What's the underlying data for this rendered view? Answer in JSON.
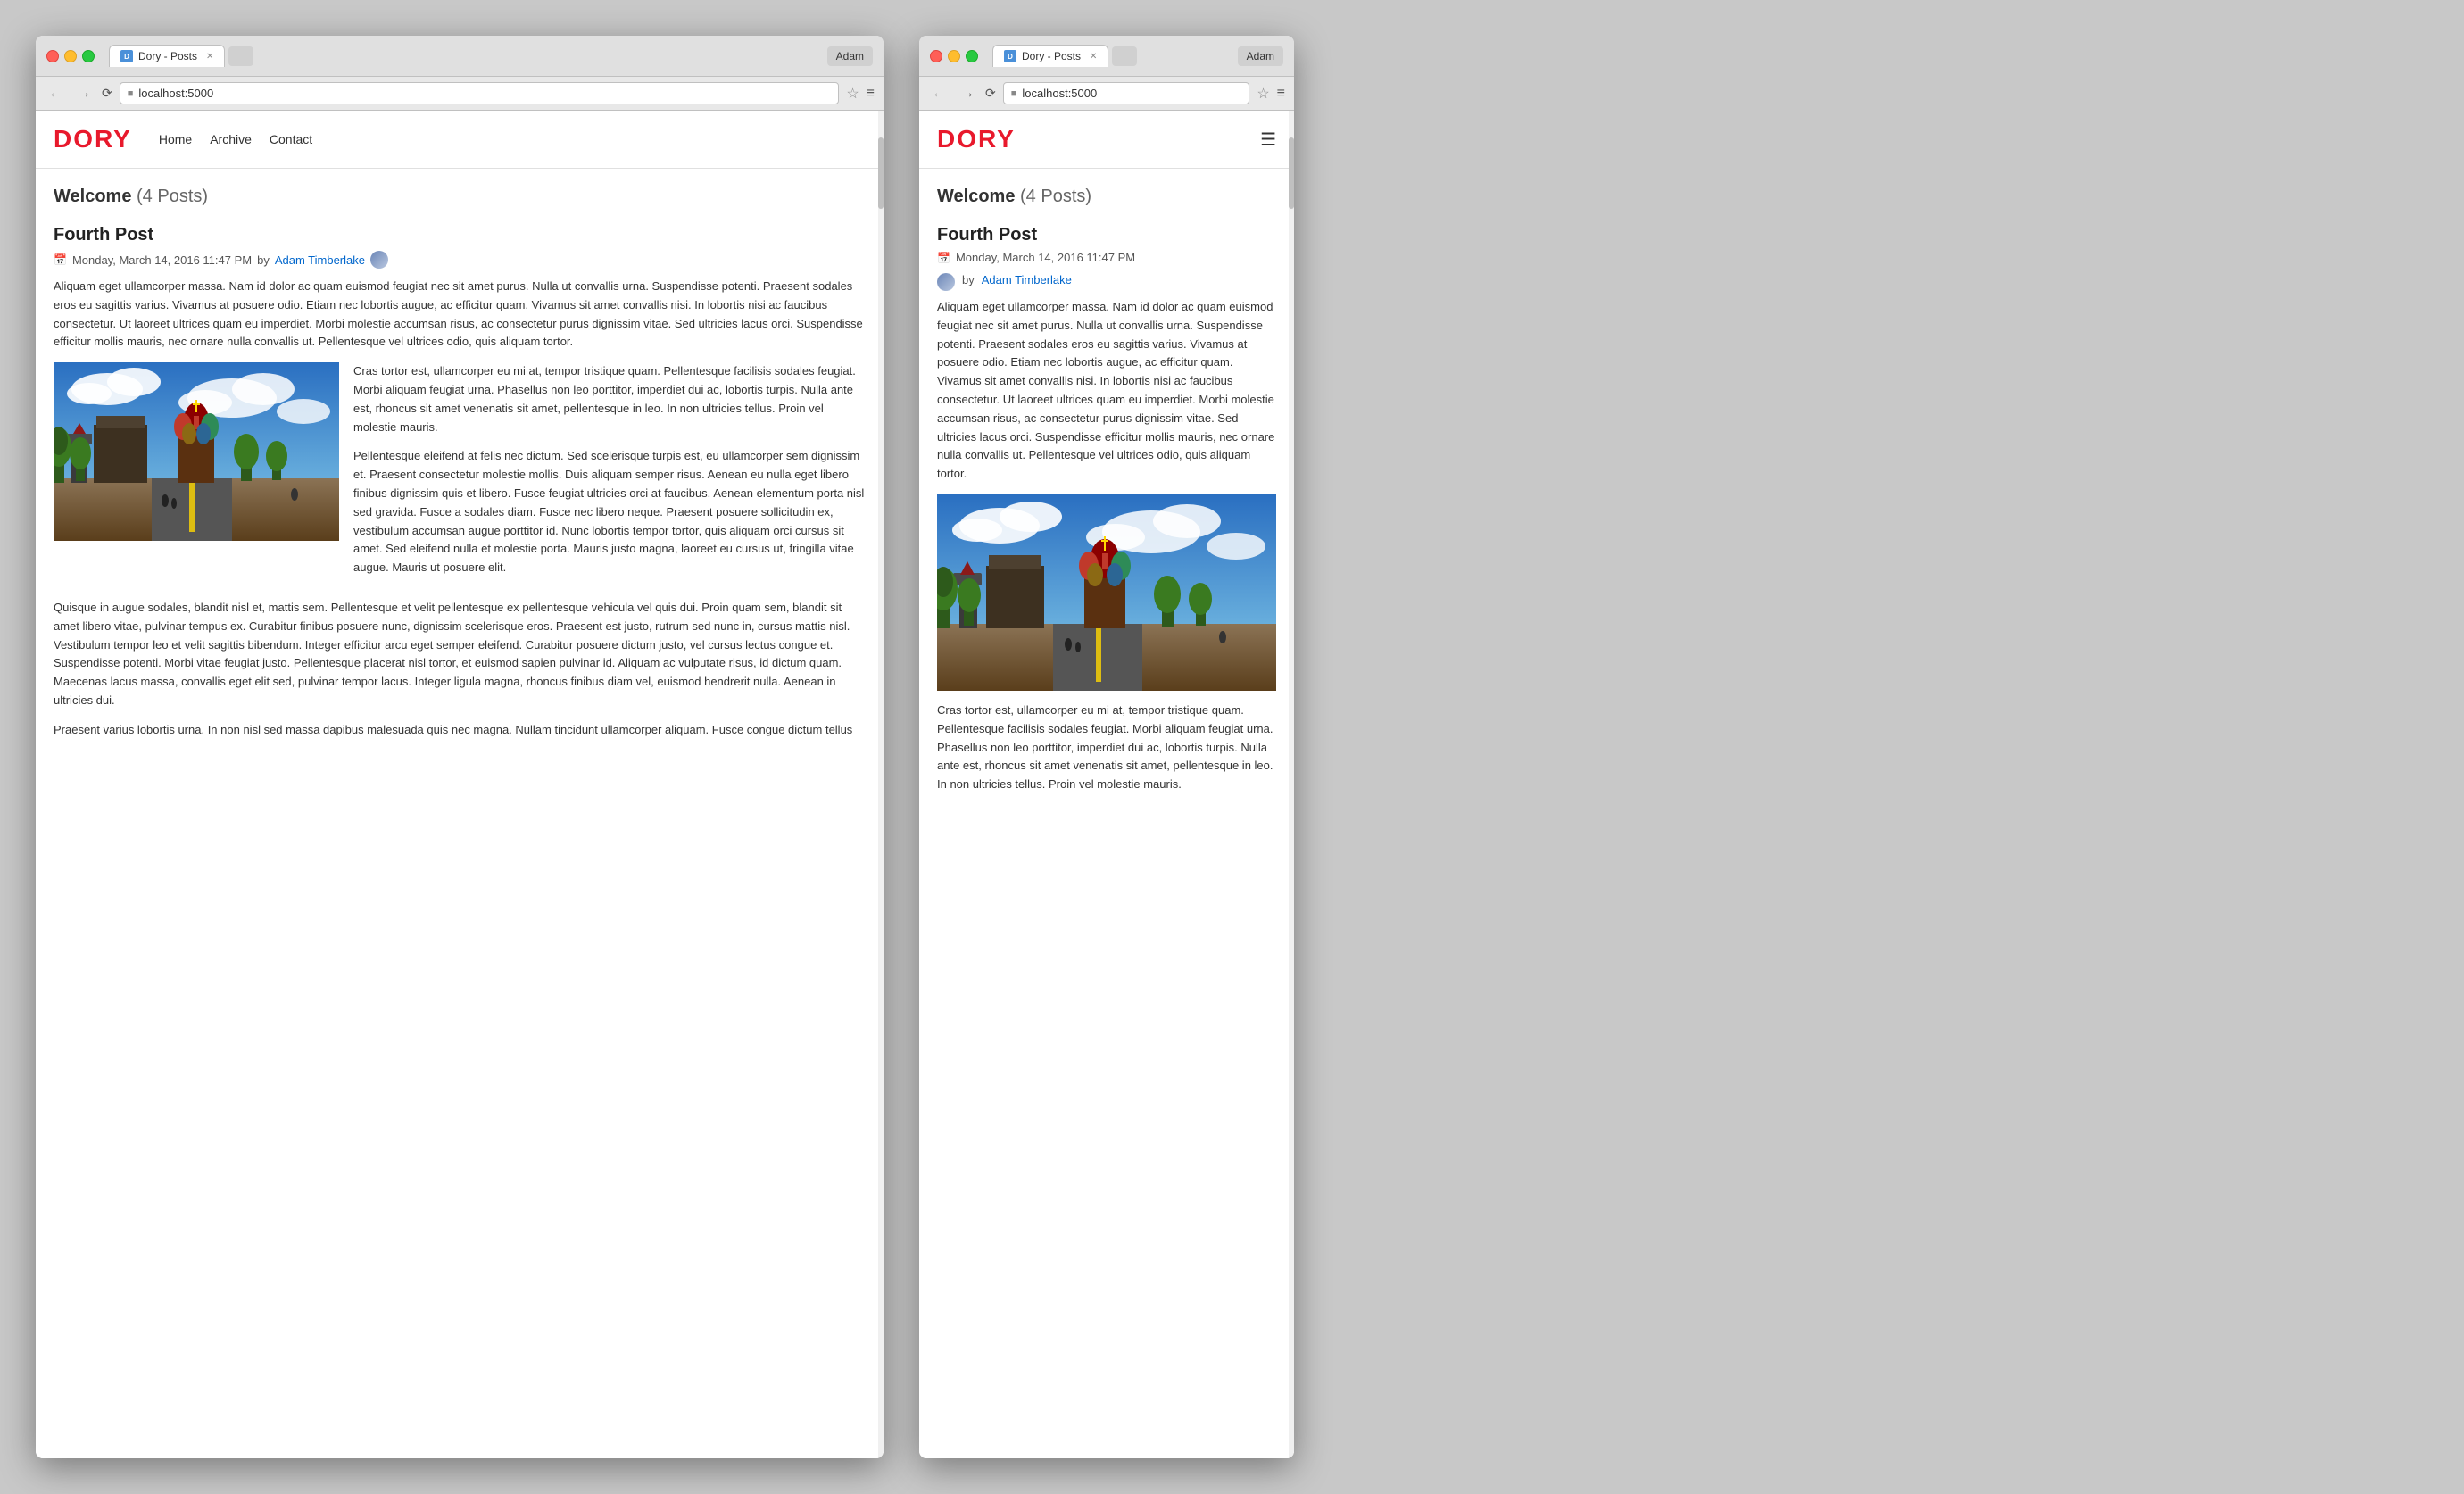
{
  "browser_left": {
    "title": "Dory - Posts",
    "url": "localhost:5000",
    "user_button": "Adam",
    "favicon_letter": "D"
  },
  "browser_right": {
    "title": "Dory - Posts",
    "url": "localhost:5000",
    "user_button": "Adam",
    "favicon_letter": "D"
  },
  "site": {
    "logo": "DORY",
    "nav": [
      "Home",
      "Archive",
      "Contact"
    ]
  },
  "page": {
    "welcome_text": "Welcome",
    "post_count": "(4 Posts)",
    "post_title": "Fourth Post",
    "post_date": "Monday, March 14, 2016 11:47 PM",
    "post_by": "by",
    "author_name": "Adam Timberlake",
    "post_body_1": "Aliquam eget ullamcorper massa. Nam id dolor ac quam euismod feugiat nec sit amet purus. Nulla ut convallis urna. Suspendisse potenti. Praesent sodales eros eu sagittis varius. Vivamus at posuere odio. Etiam nec lobortis augue, ac efficitur quam. Vivamus sit amet convallis nisi. In lobortis nisi ac faucibus consectetur. Ut laoreet ultrices quam eu imperdiet. Morbi molestie accumsan risus, ac consectetur purus dignissim vitae. Sed ultricies lacus orci. Suspendisse efficitur mollis mauris, nec ornare nulla convallis ut. Pellentesque vel ultrices odio, quis aliquam tortor.",
    "post_body_right": "Cras tortor est, ullamcorper eu mi at, tempor tristique quam. Pellentesque facilisis sodales feugiat. Morbi aliquam feugiat urna. Phasellus non leo porttitor, imperdiet dui ac, lobortis turpis. Nulla ante est, rhoncus sit amet venenatis sit amet, pellentesque in leo. In non ultricies tellus. Proin vel molestie mauris.",
    "post_body_right_2": "Pellentesque eleifend at felis nec dictum. Sed scelerisque turpis est, eu ullamcorper sem dignissim et. Praesent consectetur molestie mollis. Duis aliquam semper risus. Aenean eu nulla eget libero finibus dignissim quis et libero. Fusce feugiat ultricies orci at faucibus. Aenean elementum porta nisl sed gravida. Fusce a sodales diam. Fusce nec libero neque. Praesent posuere sollicitudin ex, vestibulum accumsan augue porttitor id. Nunc lobortis tempor tortor, quis aliquam orci cursus sit amet. Sed eleifend nulla et molestie porta. Mauris justo magna, laoreet eu cursus ut, fringilla vitae augue. Mauris ut posuere elit.",
    "post_body_3": "Quisque in augue sodales, blandit nisl et, mattis sem. Pellentesque et velit pellentesque ex pellentesque vehicula vel quis dui. Proin quam sem, blandit sit amet libero vitae, pulvinar tempus ex. Curabitur finibus posuere nunc, dignissim scelerisque eros. Praesent est justo, rutrum sed nunc in, cursus mattis nisl. Vestibulum tempor leo et velit sagittis bibendum. Integer efficitur arcu eget semper eleifend. Curabitur posuere dictum justo, vel cursus lectus congue et. Suspendisse potenti. Morbi vitae feugiat justo. Pellentesque placerat nisl tortor, et euismod sapien pulvinar id. Aliquam ac vulputate risus, id dictum quam. Maecenas lacus massa, convallis eget elit sed, pulvinar tempor lacus. Integer ligula magna, rhoncus finibus diam vel, euismod hendrerit nulla. Aenean in ultricies dui.",
    "post_body_4": "Praesent varius lobortis urna. In non nisl sed massa dapibus malesuada quis nec magna. Nullam tincidunt ullamcorper aliquam. Fusce congue dictum tellus",
    "mobile_body_1": "Aliquam eget ullamcorper massa. Nam id dolor ac quam euismod feugiat nec sit amet purus. Nulla ut convallis urna. Suspendisse potenti. Praesent sodales eros eu sagittis varius. Vivamus at posuere odio. Etiam nec lobortis augue, ac efficitur quam. Vivamus sit amet convallis nisi. In lobortis nisi ac faucibus consectetur. Ut laoreet ultrices quam eu imperdiet. Morbi molestie accumsan risus, ac consectetur purus dignissim vitae. Sed ultricies lacus orci. Suspendisse efficitur mollis mauris, nec ornare nulla convallis ut. Pellentesque vel ultrices odio, quis aliquam tortor.",
    "mobile_body_2": "Cras tortor est, ullamcorper eu mi at, tempor tristique quam. Pellentesque facilisis sodales feugiat. Morbi aliquam feugiat urna. Phasellus non leo porttitor, imperdiet dui ac, lobortis turpis. Nulla ante est, rhoncus sit amet venenatis sit amet, pellentesque in leo. In non ultricies tellus. Proin vel molestie mauris."
  }
}
